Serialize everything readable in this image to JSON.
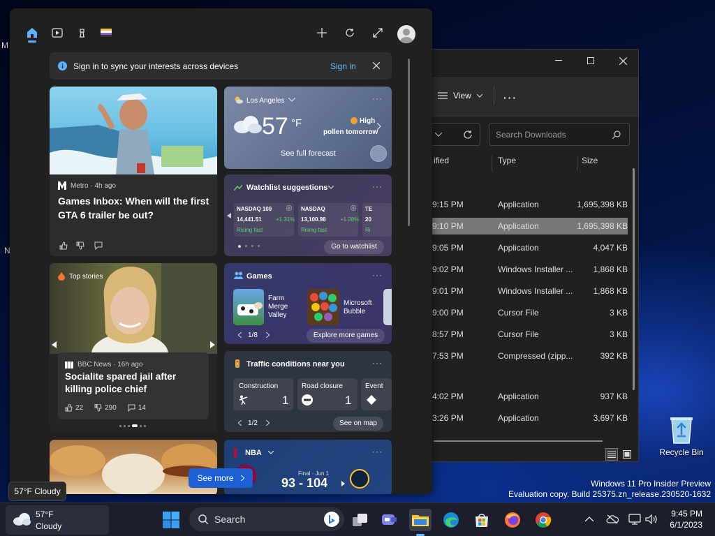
{
  "desktop": {
    "edge_letters": [
      "M",
      "N"
    ],
    "recycle_label": "Recycle Bin",
    "watermark_line1": "Windows 11 Pro Insider Preview",
    "watermark_line2": "Evaluation copy. Build 25375.zn_release.230520-1632"
  },
  "explorer": {
    "view_label": "View",
    "search_placeholder": "Search Downloads",
    "columns": {
      "modified": "ified",
      "type": "Type",
      "size": "Size"
    },
    "rows": [
      {
        "time": "9:15 PM",
        "type": "Application",
        "size": "1,695,398 KB",
        "selected": false
      },
      {
        "time": "9:10 PM",
        "type": "Application",
        "size": "1,695,398 KB",
        "selected": true
      },
      {
        "time": "9:05 PM",
        "type": "Application",
        "size": "4,047 KB",
        "selected": false
      },
      {
        "time": "9:02 PM",
        "type": "Windows Installer ...",
        "size": "1,868 KB",
        "selected": false
      },
      {
        "time": "9:01 PM",
        "type": "Windows Installer ...",
        "size": "1,868 KB",
        "selected": false
      },
      {
        "time": "9:00 PM",
        "type": "Cursor File",
        "size": "3 KB",
        "selected": false
      },
      {
        "time": "8:57 PM",
        "type": "Cursor File",
        "size": "3 KB",
        "selected": false
      },
      {
        "time": "7:53 PM",
        "type": "Compressed (zipp...",
        "size": "392 KB",
        "selected": false
      },
      {
        "time": "4:02 PM",
        "type": "Application",
        "size": "937 KB",
        "selected": false
      },
      {
        "time": "3:26 PM",
        "type": "Application",
        "size": "3,697 KB",
        "selected": false
      }
    ]
  },
  "widgets": {
    "signin_text": "Sign in to sync your interests across devices",
    "signin_link": "Sign in",
    "news1": {
      "source": "Metro · 4h ago",
      "headline": "Games Inbox: When will the first GTA 6 trailer be out?"
    },
    "weather": {
      "location": "Los Angeles",
      "temp": "57",
      "unit": "°F",
      "alert": "High",
      "alert_line2": "pollen tomorrow",
      "forecast_link": "See full forecast"
    },
    "watchlist": {
      "title": "Watchlist suggestions",
      "stocks": [
        {
          "name": "NASDAQ 100",
          "value": "14,441.51",
          "change": "+1.31%",
          "status": "Rising fast"
        },
        {
          "name": "NASDAQ",
          "value": "13,100.98",
          "change": "+1.28%",
          "status": "Rising fast"
        },
        {
          "name": "TE",
          "value": "20",
          "change": "",
          "status": "Ri"
        }
      ],
      "link": "Go to watchlist"
    },
    "topstories": {
      "label": "Top stories",
      "source": "BBC News · 16h ago",
      "headline": "Socialite spared jail after killing police chief",
      "likes": "22",
      "dislikes": "290",
      "comments": "14"
    },
    "games": {
      "title": "Games",
      "items": [
        {
          "name": "Farm Merge Valley"
        },
        {
          "name": "Microsoft Bubble"
        }
      ],
      "page": "1/8",
      "link": "Explore more games"
    },
    "traffic": {
      "title": "Traffic conditions near you",
      "items": [
        {
          "label": "Construction",
          "count": "1"
        },
        {
          "label": "Road closure",
          "count": "1"
        },
        {
          "label": "Event",
          "count": ""
        }
      ],
      "page": "1/2",
      "link": "See on map"
    },
    "nba": {
      "title": "NBA",
      "status": "Final · Jun 1",
      "score": "93 - 104"
    },
    "see_more": "See more"
  },
  "weather_tooltip": "57°F Cloudy",
  "taskbar": {
    "weather_temp": "57°F",
    "weather_cond": "Cloudy",
    "search_label": "Search",
    "time": "9:45 PM",
    "date": "6/1/2023"
  }
}
